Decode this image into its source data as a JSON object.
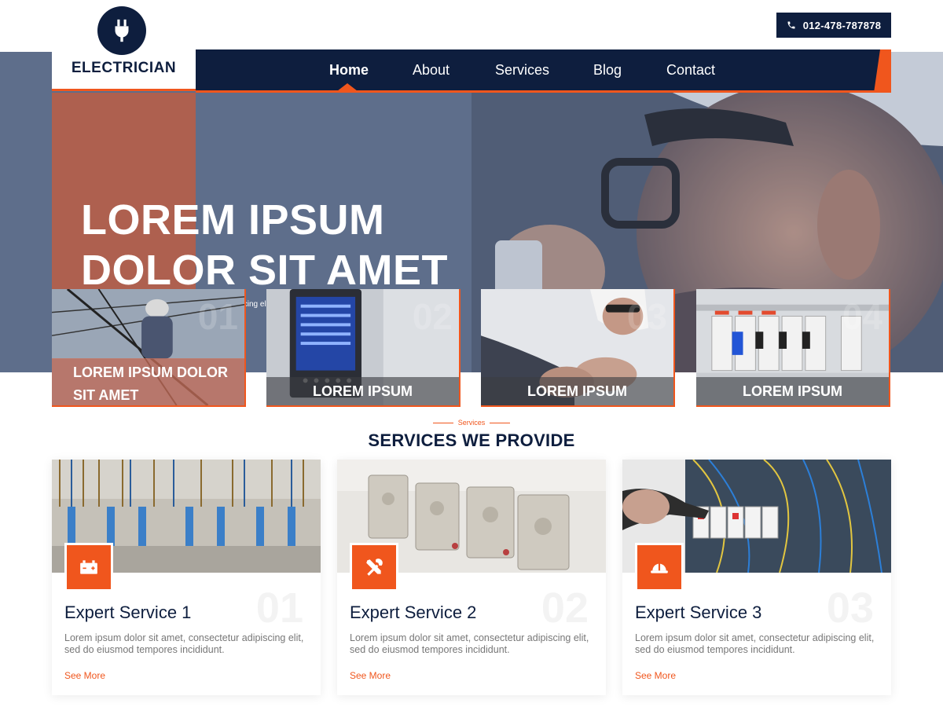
{
  "brand": {
    "name": "ELECTRICIAN",
    "logo_icon": "plug-icon"
  },
  "topbar": {
    "phone": "012-478-787878",
    "phone_icon": "phone-icon"
  },
  "nav": {
    "items": [
      {
        "label": "Home",
        "active": true
      },
      {
        "label": "About",
        "active": false
      },
      {
        "label": "Services",
        "active": false
      },
      {
        "label": "Blog",
        "active": false
      },
      {
        "label": "Contact",
        "active": false
      }
    ]
  },
  "hero": {
    "title_line1": "LOREM IPSUM",
    "title_line2": "DOLOR SIT AMET",
    "text": "Lorem ipsum dolor sit amet, consectetur adipiscing elit, sed do eiusmod tempor incididunt ut labore et dolore magna aliqua."
  },
  "features": [
    {
      "caption": "LOREM IPSUM DOLOR SIT AMET",
      "number": "01"
    },
    {
      "caption": "LOREM IPSUM",
      "number": "02"
    },
    {
      "caption": "LOREM IPSUM",
      "number": "03"
    },
    {
      "caption": "LOREM IPSUM",
      "number": "04"
    }
  ],
  "services": {
    "eyebrow": "Services",
    "title": "SERVICES WE PROVIDE",
    "cards": [
      {
        "name": "Expert Service 1",
        "number": "01",
        "icon": "battery-icon",
        "desc": "Lorem ipsum dolor sit amet, consectetur adipiscing elit, sed do eiusmod tempores incididunt.",
        "link": "See More"
      },
      {
        "name": "Expert Service 2",
        "number": "02",
        "icon": "tools-icon",
        "desc": "Lorem ipsum dolor sit amet, consectetur adipiscing elit, sed do eiusmod tempores incididunt.",
        "link": "See More"
      },
      {
        "name": "Expert Service 3",
        "number": "03",
        "icon": "hardhat-icon",
        "desc": "Lorem ipsum dolor sit amet, consectetur adipiscing elit, sed do eiusmod tempores incididunt.",
        "link": "See More"
      }
    ]
  },
  "colors": {
    "navy": "#0e1e3e",
    "accent": "#f0561d"
  }
}
